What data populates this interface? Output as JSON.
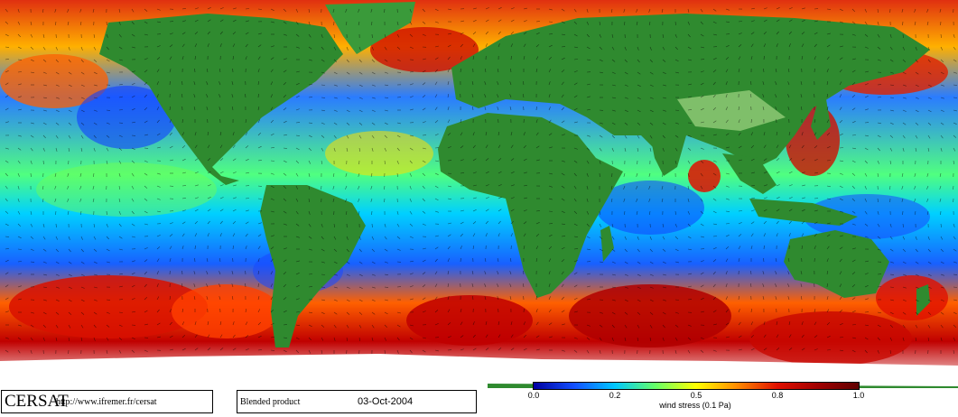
{
  "credit": {
    "logo": "CERSAT",
    "url": "http://www.ifremer.fr/cersat"
  },
  "product": {
    "label": "Blended product",
    "date": "03-Oct-2004"
  },
  "colorbar": {
    "title": "wind stress (0.1 Pa)",
    "ticks": [
      "0.0",
      "0.2",
      "0.5",
      "0.8",
      "1.0"
    ],
    "tick_values": [
      0.0,
      0.25,
      0.5,
      0.75,
      1.0
    ],
    "min": 0.0,
    "max": 1.0,
    "stops": [
      "#0000a0",
      "#1450ff",
      "#00c8ff",
      "#66ff66",
      "#ffff00",
      "#ff8c00",
      "#e01000",
      "#a00000",
      "#600000"
    ]
  },
  "colors": {
    "land": "#2f8a2f",
    "land_high": "#7fbf6a",
    "ice": "#ffffff",
    "ocean_low": "#1450ff",
    "ocean_mid": "#39e3ff",
    "ocean_high": "#e01000"
  }
}
